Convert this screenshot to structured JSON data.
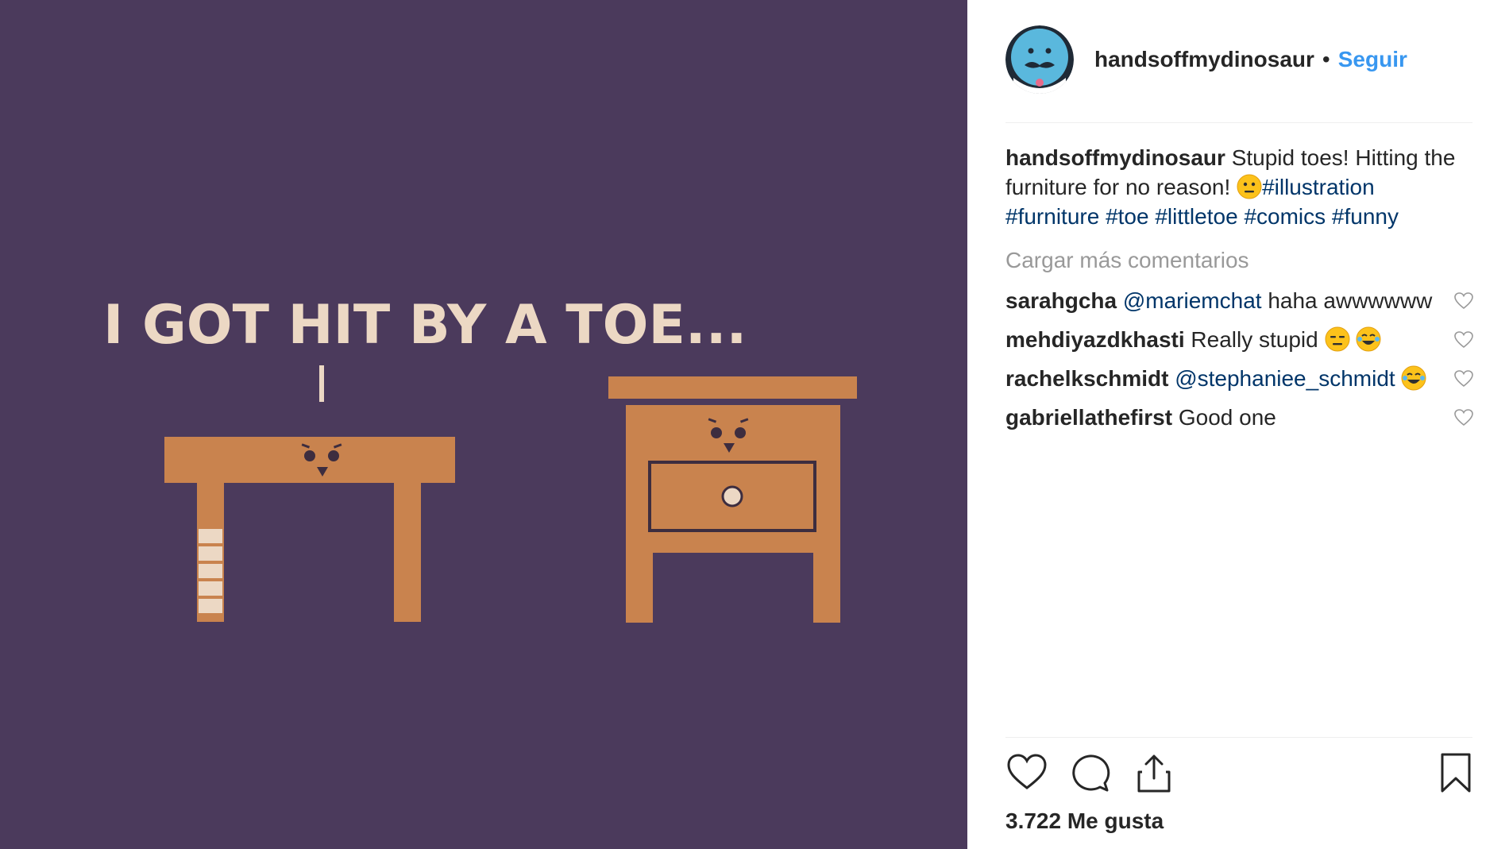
{
  "media": {
    "caption_text": "I GOT HIT BY A TOE...",
    "colors": {
      "background": "#4b3a5c",
      "wood": "#c9834e",
      "text": "#ecd8c4",
      "face": "#3d2d3f"
    }
  },
  "header": {
    "username": "handsoffmydinosaur",
    "separator": "•",
    "follow_label": "Seguir"
  },
  "caption": {
    "username": "handsoffmydinosaur",
    "text": "Stupid toes! Hitting the furniture for no reason!",
    "emoji": "neutral-face-emoji",
    "hashtags": [
      "#illustration",
      "#furniture",
      "#toe",
      "#littletoe",
      "#comics",
      "#funny"
    ]
  },
  "load_more_label": "Cargar más comentarios",
  "comments": [
    {
      "username": "sarahgcha",
      "mention": "@mariemchat",
      "text": "haha awwwwww",
      "emojis": []
    },
    {
      "username": "mehdiyazdkhasti",
      "mention": "",
      "text": "Really stupid",
      "emojis": [
        "expressionless-face-emoji",
        "tears-of-joy-emoji"
      ]
    },
    {
      "username": "rachelkschmidt",
      "mention": "@stephaniee_schmidt",
      "text": "",
      "emojis": [
        "tears-of-joy-emoji"
      ]
    },
    {
      "username": "gabriellathefirst",
      "mention": "",
      "text": "Good one",
      "emojis": []
    }
  ],
  "actions": {
    "icons": [
      "heart-icon",
      "comment-icon",
      "share-icon",
      "bookmark-icon"
    ]
  },
  "likes_count": "3.722 Me gusta",
  "accent_color": "#3897f0"
}
